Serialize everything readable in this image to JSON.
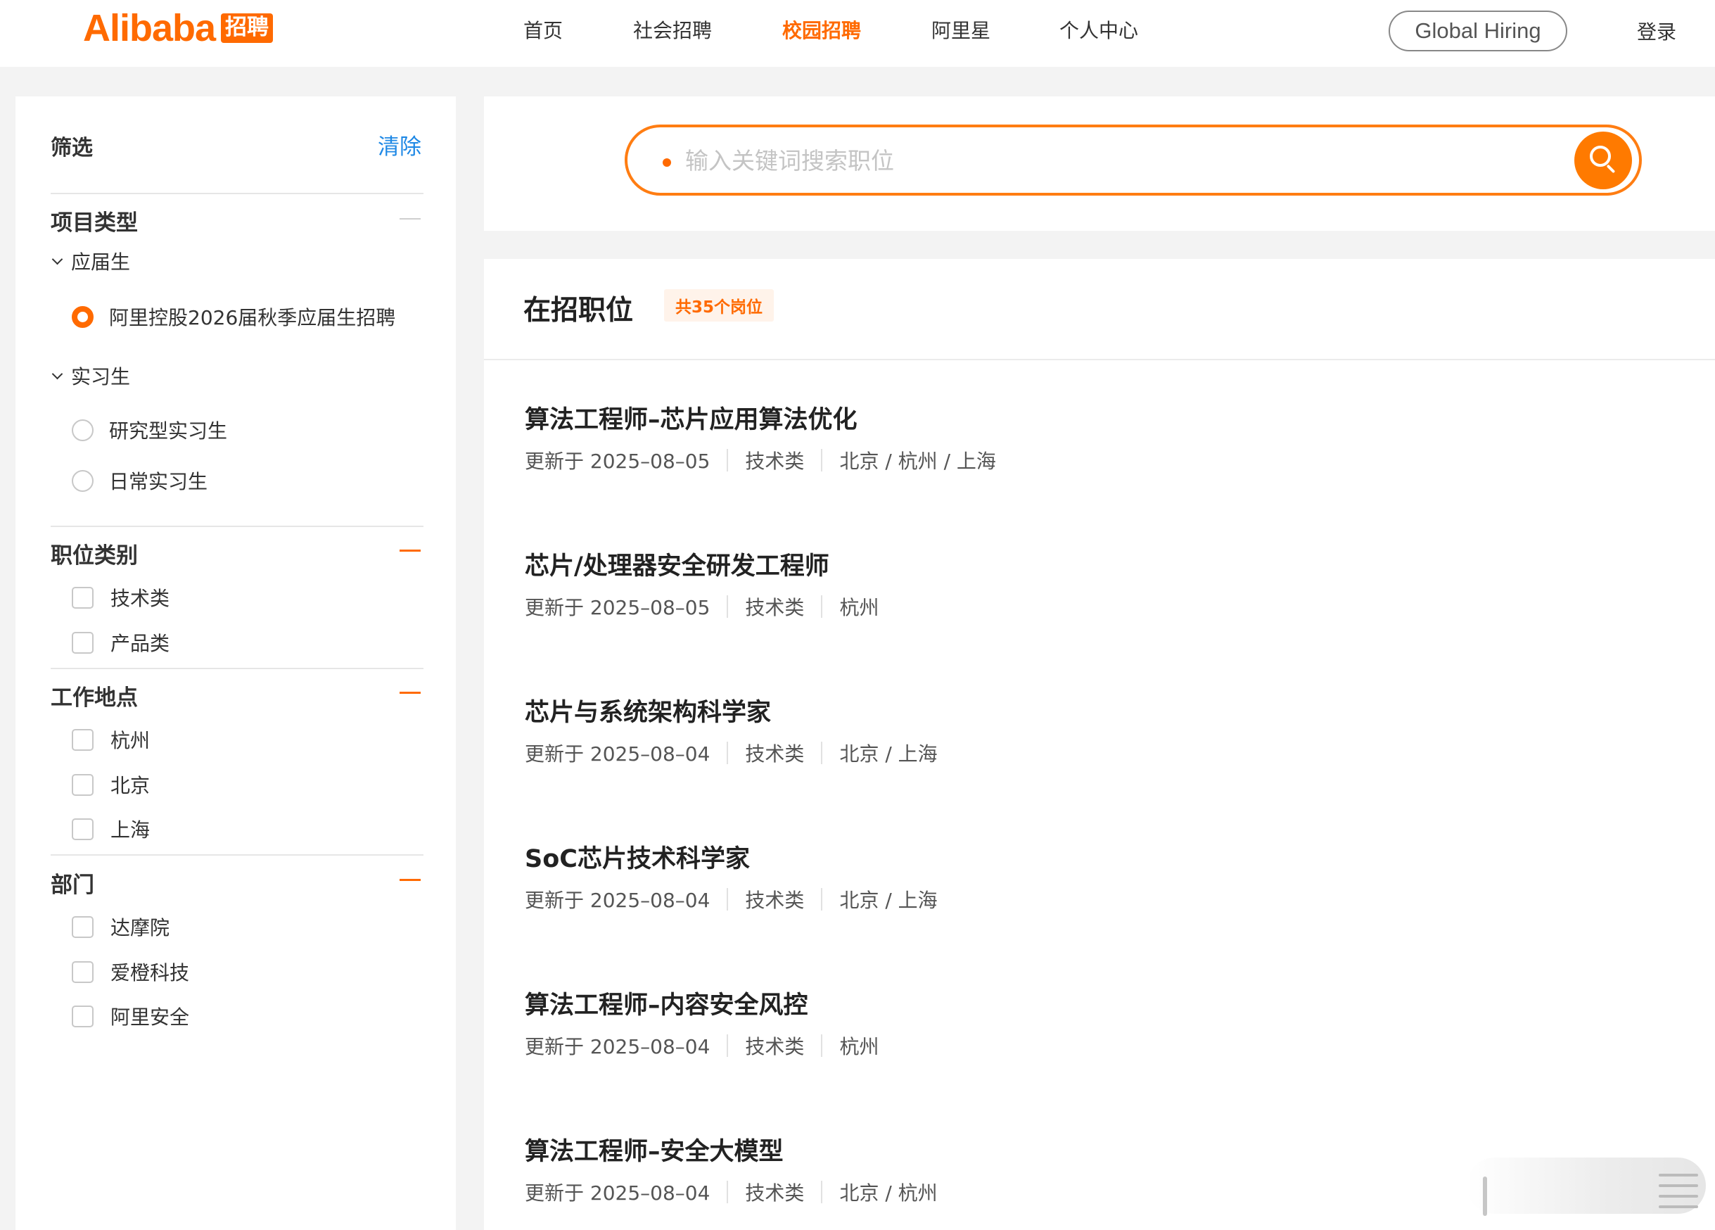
{
  "header": {
    "logo_word": "Alibaba",
    "logo_badge": "招聘",
    "nav": [
      "首页",
      "社会招聘",
      "校园招聘",
      "阿里星",
      "个人中心"
    ],
    "active_nav": "校园招聘",
    "global_hiring": "Global Hiring",
    "login": "登录"
  },
  "sidebar": {
    "title": "筛选",
    "clear": "清除",
    "project_type": {
      "title": "项目类型",
      "graduate_group": "应届生",
      "graduate_options": [
        "阿里控股2026届秋季应届生招聘"
      ],
      "intern_group": "实习生",
      "intern_options": [
        "研究型实习生",
        "日常实习生"
      ]
    },
    "job_category": {
      "title": "职位类别",
      "options": [
        "技术类",
        "产品类"
      ]
    },
    "location": {
      "title": "工作地点",
      "options": [
        "杭州",
        "北京",
        "上海"
      ]
    },
    "department": {
      "title": "部门",
      "options": [
        "达摩院",
        "爱橙科技",
        "阿里安全"
      ]
    }
  },
  "search": {
    "placeholder": "输入关键词搜索职位",
    "value": ""
  },
  "jobs": {
    "title": "在招职位",
    "count_badge": "共35个岗位",
    "items": [
      {
        "title": "算法工程师–芯片应用算法优化",
        "updated": "更新于 2025–08–05",
        "category": "技术类",
        "locations": "北京 / 杭州 / 上海"
      },
      {
        "title": "芯片/处理器安全研发工程师",
        "updated": "更新于 2025–08–05",
        "category": "技术类",
        "locations": "杭州"
      },
      {
        "title": "芯片与系统架构科学家",
        "updated": "更新于 2025–08–04",
        "category": "技术类",
        "locations": "北京 / 上海"
      },
      {
        "title": "SoC芯片技术科学家",
        "updated": "更新于 2025–08–04",
        "category": "技术类",
        "locations": "北京 / 上海"
      },
      {
        "title": "算法工程师–内容安全风控",
        "updated": "更新于 2025–08–04",
        "category": "技术类",
        "locations": "杭州"
      },
      {
        "title": "算法工程师–安全大模型",
        "updated": "更新于 2025–08–04",
        "category": "技术类",
        "locations": "北京 / 杭州"
      }
    ]
  },
  "colors": {
    "accent": "#ff6a00",
    "link": "#1e88e5",
    "page_bg": "#f3f3f3"
  },
  "icons": {
    "search": "search-icon",
    "collapse": "minus-icon",
    "expand_group": "chevron-down-icon"
  }
}
